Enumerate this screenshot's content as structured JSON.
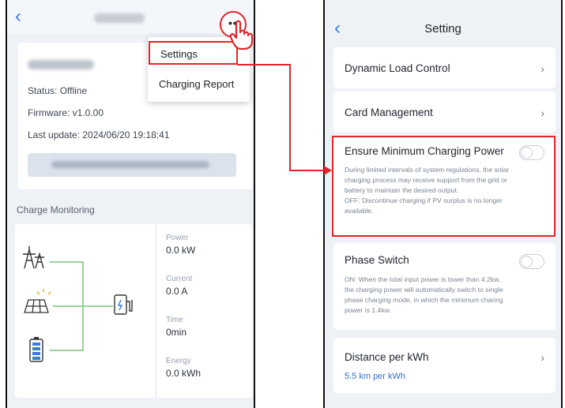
{
  "left_screen": {
    "status_text": "Status: Offline",
    "firmware_text": "Firmware: v1.0.00",
    "last_update_text": "Last update: 2024/06/20 19:18:41",
    "charge_monitoring_label": "Charge Monitoring",
    "metrics": [
      {
        "label": "Power",
        "value": "0.0 kW"
      },
      {
        "label": "Current",
        "value": "0.0 A"
      },
      {
        "label": "Time",
        "value": "0min"
      },
      {
        "label": "Energy",
        "value": "0.0 kWh"
      }
    ],
    "menu": {
      "settings_label": "Settings",
      "charging_report_label": "Charging Report"
    }
  },
  "right_screen": {
    "title": "Setting",
    "dynamic_load_control": "Dynamic Load Control",
    "card_management": "Card Management",
    "ensure_min_power": {
      "title": "Ensure Minimum Charging Power",
      "enabled": false,
      "description_line1": "During limited intervals of system regulations, the solar",
      "description_line2": "charging process may receive support from the grid or",
      "description_line3": "battery to maintain the desired output.",
      "description_line4": "OFF:  Discontinue charging if PV surplus is no longer",
      "description_line5": "available."
    },
    "phase_switch": {
      "title": "Phase Switch",
      "enabled": false,
      "description_line1": "ON:  When the total input power is lower than 4.2kw,",
      "description_line2": "the charging power will automatically switch to single",
      "description_line3": "phase charging mode, in which the minimum charing",
      "description_line4": "power is 1.4kw."
    },
    "distance_per_kwh": {
      "title": "Distance per kWh",
      "value": "5.5 km per kWh"
    }
  },
  "icons": {
    "back": "chevron-left-icon",
    "more": "more-dots-icon",
    "hand": "pointing-hand-icon",
    "tower": "power-tower-icon",
    "solar": "solar-panel-icon",
    "battery": "battery-icon",
    "charger": "ev-charger-icon",
    "chevron_right": "chevron-right-icon"
  },
  "colors": {
    "highlight": "#e0262a",
    "accent": "#3b7ddd",
    "flow_line": "#7cc47a"
  }
}
